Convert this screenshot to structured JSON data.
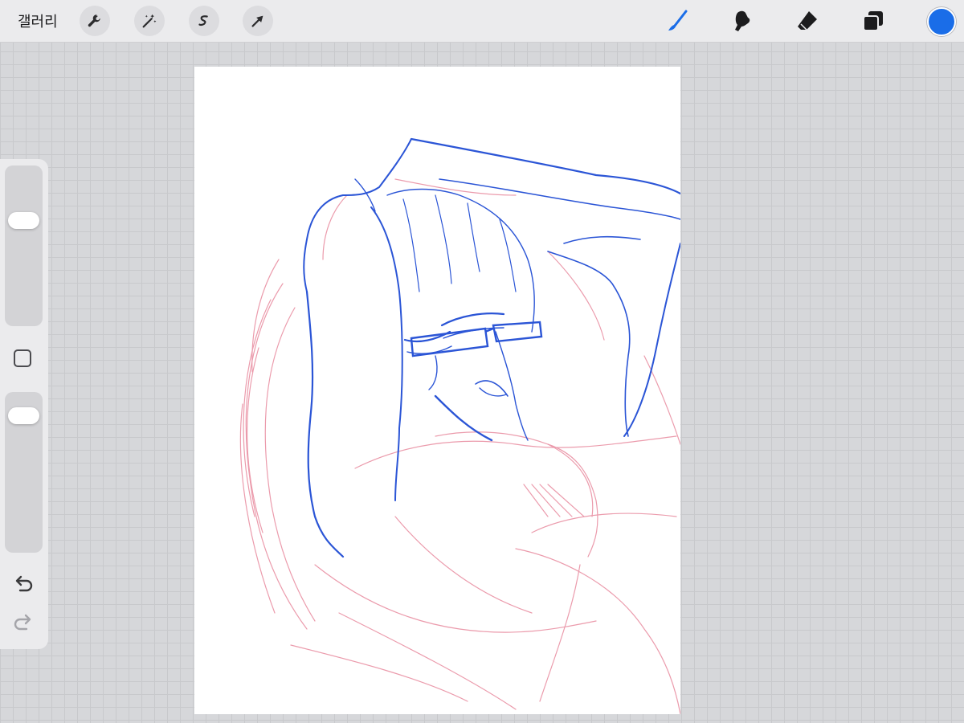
{
  "toolbar": {
    "gallery_label": "갤러리",
    "left_tools": [
      "wrench-icon",
      "magic-wand-icon",
      "selection-icon",
      "transform-arrow-icon"
    ],
    "right_tools": [
      "brush-icon",
      "smudge-icon",
      "eraser-icon",
      "layers-icon"
    ],
    "active_tool": "brush",
    "current_color": "#1a6de8"
  },
  "sidebar": {
    "brush_size_level": 0.69,
    "opacity_level": 0.92,
    "undo_enabled": true,
    "redo_enabled": false
  },
  "canvas": {
    "sketch_colors": [
      "#2b55d6",
      "#e88a9e"
    ]
  }
}
